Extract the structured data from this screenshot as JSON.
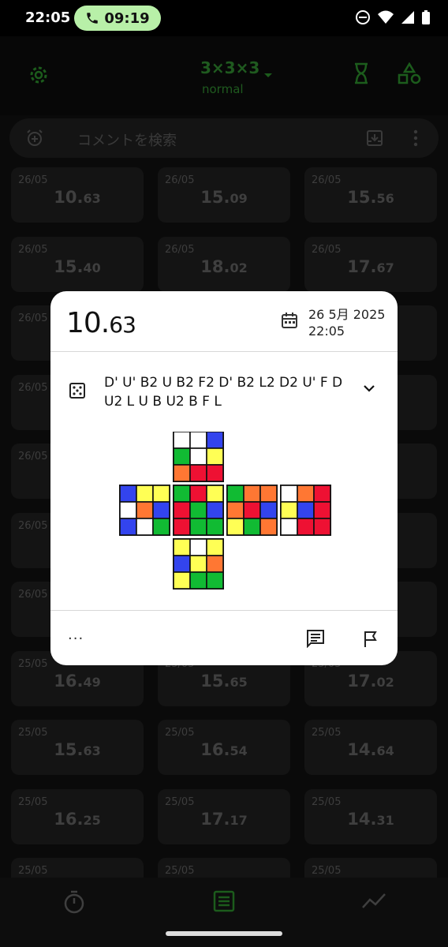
{
  "status": {
    "time": "22:05",
    "call_time": "09:19"
  },
  "appbar": {
    "puzzle": "3×3×3",
    "mode": "normal"
  },
  "search": {
    "placeholder": "コメントを検索"
  },
  "solves": [
    {
      "date": "26/05",
      "main": "10.",
      "cs": "63"
    },
    {
      "date": "26/05",
      "main": "15.",
      "cs": "09"
    },
    {
      "date": "26/05",
      "main": "15.",
      "cs": "56"
    },
    {
      "date": "26/05",
      "main": "15.",
      "cs": "40"
    },
    {
      "date": "26/05",
      "main": "18.",
      "cs": "02"
    },
    {
      "date": "26/05",
      "main": "17.",
      "cs": "67"
    },
    {
      "date": "26/05",
      "main": "",
      "cs": ""
    },
    {
      "date": "",
      "main": "",
      "cs": ""
    },
    {
      "date": "",
      "main": "",
      "cs": ""
    },
    {
      "date": "26/05",
      "main": "",
      "cs": ""
    },
    {
      "date": "",
      "main": "",
      "cs": ""
    },
    {
      "date": "",
      "main": "",
      "cs": ""
    },
    {
      "date": "26/05",
      "main": "",
      "cs": ""
    },
    {
      "date": "",
      "main": "",
      "cs": ""
    },
    {
      "date": "",
      "main": "",
      "cs": ""
    },
    {
      "date": "26/05",
      "main": "",
      "cs": ""
    },
    {
      "date": "",
      "main": "",
      "cs": ""
    },
    {
      "date": "",
      "main": "",
      "cs": ""
    },
    {
      "date": "26/05",
      "main": "",
      "cs": ""
    },
    {
      "date": "",
      "main": "",
      "cs": ""
    },
    {
      "date": "",
      "main": "",
      "cs": ""
    },
    {
      "date": "25/05",
      "main": "16.",
      "cs": "49"
    },
    {
      "date": "25/05",
      "main": "15.",
      "cs": "65"
    },
    {
      "date": "25/05",
      "main": "17.",
      "cs": "02"
    },
    {
      "date": "25/05",
      "main": "15.",
      "cs": "63"
    },
    {
      "date": "25/05",
      "main": "16.",
      "cs": "54"
    },
    {
      "date": "25/05",
      "main": "14.",
      "cs": "64"
    },
    {
      "date": "25/05",
      "main": "16.",
      "cs": "25"
    },
    {
      "date": "25/05",
      "main": "17.",
      "cs": "17"
    },
    {
      "date": "25/05",
      "main": "14.",
      "cs": "31"
    },
    {
      "date": "25/05",
      "main": "",
      "cs": ""
    },
    {
      "date": "25/05",
      "main": "",
      "cs": ""
    },
    {
      "date": "25/05",
      "main": "",
      "cs": ""
    }
  ],
  "dialog": {
    "time_main": "10.",
    "time_cs": "63",
    "date_line1": "26 5月 2025",
    "date_line2": "22:05",
    "scramble": "D' U' B2 U B2 F2 D' B2 L2 D2 U' F D U2 L U B U2 B F L",
    "more": "···"
  },
  "cube": {
    "colors": {
      "W": "#ffffff",
      "Y": "#ffff55",
      "R": "#ee1133",
      "O": "#ff7733",
      "G": "#11bb33",
      "B": "#3344ee"
    },
    "U": [
      "W",
      "W",
      "B",
      "G",
      "W",
      "Y",
      "O",
      "R",
      "R"
    ],
    "L": [
      "B",
      "Y",
      "Y",
      "W",
      "O",
      "B",
      "B",
      "W",
      "G"
    ],
    "F": [
      "G",
      "R",
      "Y",
      "R",
      "G",
      "B",
      "R",
      "G",
      "G"
    ],
    "R": [
      "G",
      "O",
      "O",
      "O",
      "R",
      "B",
      "Y",
      "G",
      "O"
    ],
    "B": [
      "W",
      "O",
      "R",
      "Y",
      "B",
      "R",
      "W",
      "R",
      "R"
    ],
    "D": [
      "Y",
      "W",
      "Y",
      "B",
      "Y",
      "O",
      "Y",
      "G",
      "G"
    ]
  }
}
